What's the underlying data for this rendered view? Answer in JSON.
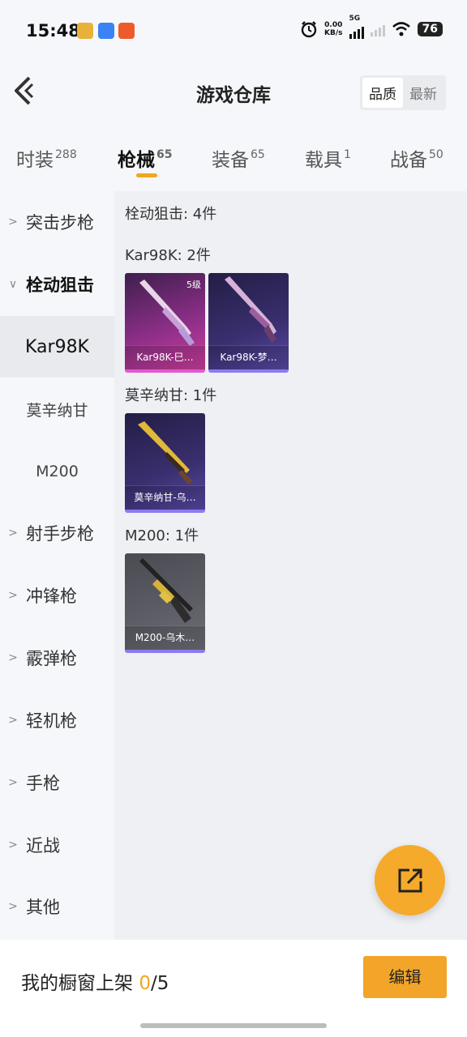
{
  "status_bar": {
    "time": "15:48",
    "net_speed_value": "0.00",
    "net_speed_unit": "KB/s",
    "network_type": "5G",
    "battery": "76"
  },
  "header": {
    "title": "游戏仓库",
    "sort_quality": "品质",
    "sort_newest": "最新"
  },
  "tabs": [
    {
      "label": "时装",
      "count": "288"
    },
    {
      "label": "枪械",
      "count": "65"
    },
    {
      "label": "装备",
      "count": "65"
    },
    {
      "label": "载具",
      "count": "1"
    },
    {
      "label": "战备",
      "count": "50"
    }
  ],
  "sidebar": {
    "items": [
      {
        "label": "突击步枪"
      },
      {
        "label": "栓动狙击"
      },
      {
        "label": "射手步枪"
      },
      {
        "label": "冲锋枪"
      },
      {
        "label": "霰弹枪"
      },
      {
        "label": "轻机枪"
      },
      {
        "label": "手枪"
      },
      {
        "label": "近战"
      },
      {
        "label": "其他"
      }
    ],
    "subitems": [
      {
        "label": "Kar98K"
      },
      {
        "label": "莫辛纳甘"
      },
      {
        "label": "M200"
      }
    ]
  },
  "content": {
    "category_summary": "栓动狙击: 4件",
    "groups": [
      {
        "title": "Kar98K: 2件",
        "items": [
          {
            "name": "Kar98K-巳…",
            "level": "5级"
          },
          {
            "name": "Kar98K-梦…"
          }
        ]
      },
      {
        "title": "莫辛纳甘: 1件",
        "items": [
          {
            "name": "莫辛纳甘-乌…"
          }
        ]
      },
      {
        "title": "M200: 1件",
        "items": [
          {
            "name": "M200-乌木…"
          }
        ]
      }
    ]
  },
  "bottom_bar": {
    "showcase_prefix": "我的橱窗上架 ",
    "showcase_count": "0",
    "showcase_total": "/5",
    "edit_label": "编辑"
  },
  "colors": {
    "accent": "#f3a52a",
    "card_pink": "#cf3f9f",
    "card_purple": "#5a4aa8",
    "card_gray": "#5d5e66"
  },
  "icons": [
    "back-arrow-icon",
    "alarm-icon",
    "wifi-icon",
    "signal-icon",
    "chevron-right-icon",
    "chevron-down-icon",
    "share-external-icon"
  ]
}
